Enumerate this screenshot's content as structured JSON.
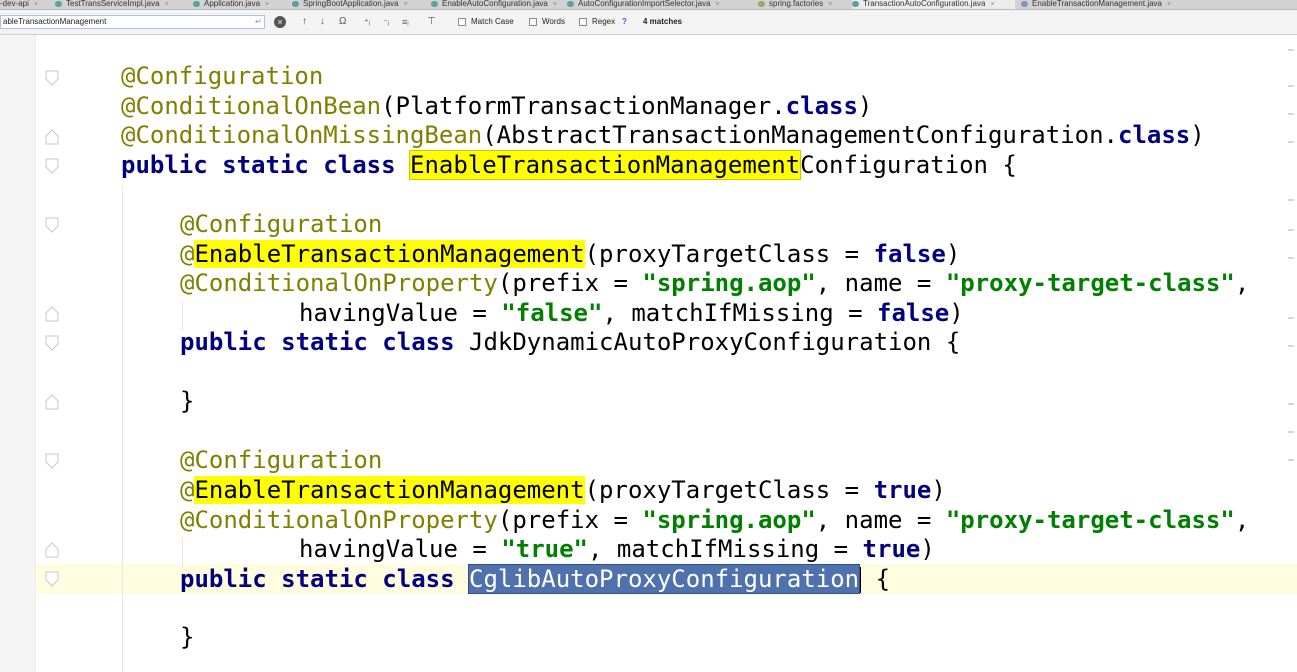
{
  "tabs": [
    {
      "label": "-dev-api",
      "active": false
    },
    {
      "label": "TestTransServiceImpl.java",
      "active": false
    },
    {
      "label": "Application.java",
      "active": false
    },
    {
      "label": "SpringBootApplication.java",
      "active": false
    },
    {
      "label": "EnableAutoConfiguration.java",
      "active": false
    },
    {
      "label": "AutoConfigurationImportSelector.java",
      "active": false
    },
    {
      "label": "spring.factories",
      "active": false
    },
    {
      "label": "TransactionAutoConfiguration.java",
      "active": true
    },
    {
      "label": "EnableTransactionManagement.java",
      "active": false
    }
  ],
  "find": {
    "value": "ableTransactionManagement",
    "match_case_label": "Match Case",
    "words_label": "Words",
    "regex_label": "Regex",
    "help_label": "?",
    "matches_label": "4 matches"
  },
  "code": {
    "l1": {
      "ann": "@Configuration"
    },
    "l2": {
      "ann": "@ConditionalOnBean",
      "rest1": "(PlatformTransactionManager.",
      "kw": "class",
      "rest2": ")"
    },
    "l3": {
      "ann": "@ConditionalOnMissingBean",
      "rest1": "(AbstractTransactionManagementConfiguration.",
      "kw": "class",
      "rest2": ")"
    },
    "l4": {
      "kw": "public static class",
      "hl": "EnableTransactionManagement",
      "rest": "Configuration {"
    },
    "l6": {
      "ann": "@Configuration"
    },
    "l7": {
      "at": "@",
      "hl": "EnableTransactionManagement",
      "rest": "(proxyTargetClass = ",
      "kw": "false",
      "end": ")"
    },
    "l8": {
      "ann": "@ConditionalOnProperty",
      "a": "(prefix = ",
      "s1": "\"spring.aop\"",
      "b": ", name = ",
      "s2": "\"proxy-target-class\"",
      "c": ","
    },
    "l9": {
      "a": "havingValue = ",
      "s": "\"false\"",
      "b": ", matchIfMissing = ",
      "kw": "false",
      "c": ")"
    },
    "l10": {
      "kw": "public static class",
      "rest": "JdkDynamicAutoProxyConfiguration {"
    },
    "l12": {
      "text": "}"
    },
    "l14": {
      "ann": "@Configuration"
    },
    "l15": {
      "at": "@",
      "hl": "EnableTransactionManagement",
      "rest": "(proxyTargetClass = ",
      "kw": "true",
      "end": ")"
    },
    "l16": {
      "ann": "@ConditionalOnProperty",
      "a": "(prefix = ",
      "s1": "\"spring.aop\"",
      "b": ", name = ",
      "s2": "\"proxy-target-class\"",
      "c": ","
    },
    "l17": {
      "a": "havingValue = ",
      "s": "\"true\"",
      "b": ", matchIfMissing = ",
      "kw": "true",
      "c": ")"
    },
    "l18": {
      "kw": "public static class",
      "sel": "CglibAutoProxyConfiguration",
      "rest": "{"
    },
    "l20": {
      "text": "}"
    }
  },
  "colors": {
    "annotation": "#808000",
    "keyword": "#000080",
    "string": "#008000",
    "search_highlight": "#ffff00",
    "selection": "#4f72ad"
  }
}
